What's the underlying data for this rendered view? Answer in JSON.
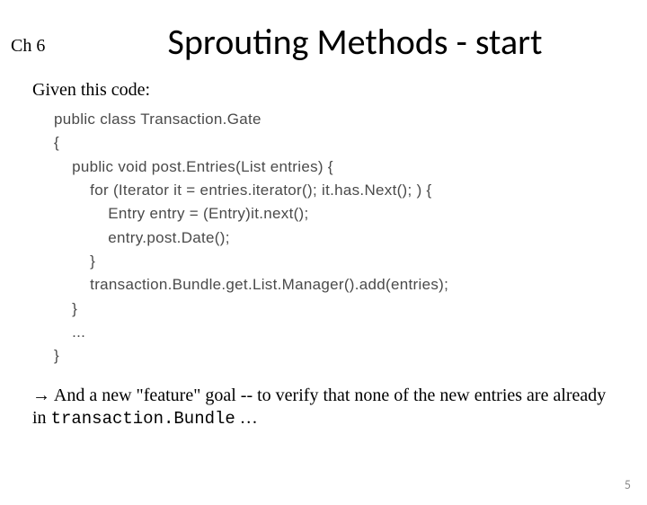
{
  "chapter": "Ch 6",
  "title": "Sprouting Methods - start",
  "subtitle": "Given this code:",
  "code": "public class Transaction.Gate\n{\n    public void post.Entries(List entries) {\n        for (Iterator it = entries.iterator(); it.has.Next(); ) {\n            Entry entry = (Entry)it.next();\n            entry.post.Date();\n        }\n        transaction.Bundle.get.List.Manager().add(entries);\n    }\n    ...\n}",
  "footer": {
    "arrow": "→",
    "part1": " And a new \"feature\" goal -- to verify that none of the new entries are already in ",
    "mono": "transaction.Bundle",
    "part2": " …"
  },
  "page_number": "5"
}
